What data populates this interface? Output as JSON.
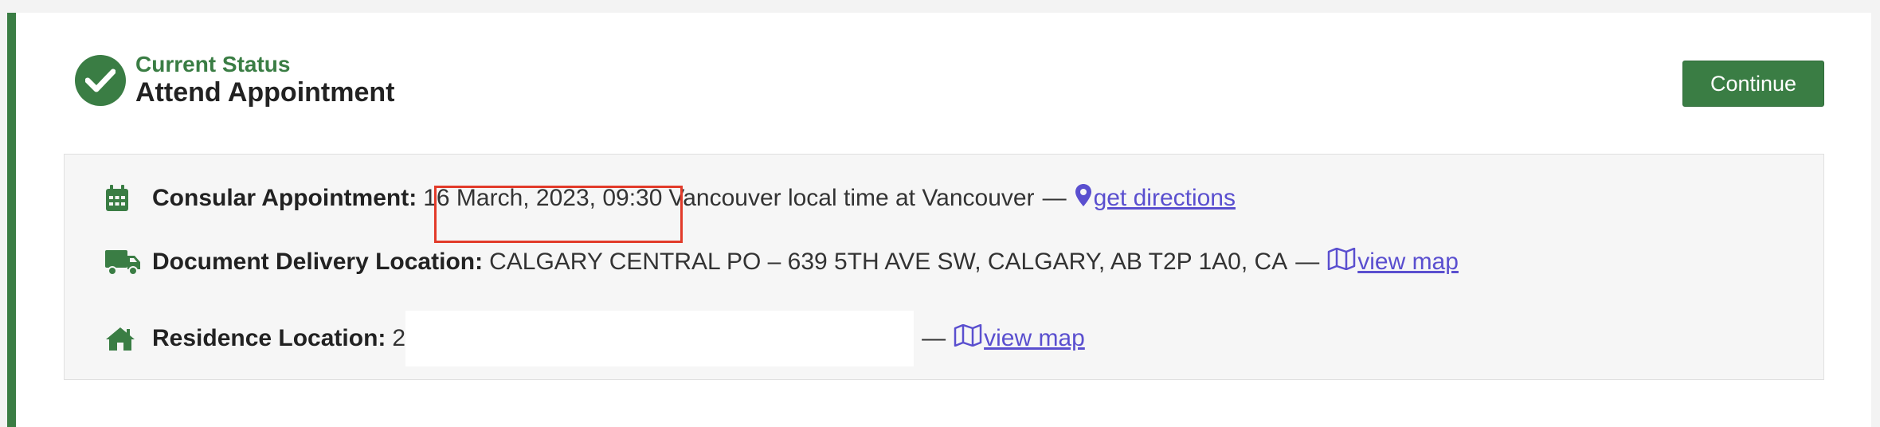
{
  "status": {
    "label": "Current Status",
    "title": "Attend Appointment",
    "icon": "check-circle-icon",
    "color": "#3a7d44"
  },
  "actions": {
    "continue_label": "Continue"
  },
  "details": {
    "consular": {
      "label": "Consular Appointment:",
      "datetime": "16 March, 2023, 09:30",
      "suffix": "Vancouver local time at Vancouver",
      "dash": "—",
      "link_label": "get directions",
      "icon": "calendar-icon",
      "link_icon": "map-pin-icon"
    },
    "delivery": {
      "label": "Document Delivery Location:",
      "value": "CALGARY CENTRAL PO – 639 5TH AVE SW, CALGARY, AB T2P 1A0, CA",
      "dash": "—",
      "link_label": "view map",
      "icon": "truck-icon",
      "link_icon": "map-icon"
    },
    "residence": {
      "label": "Residence Location:",
      "value_visible": "2",
      "dash": "—",
      "link_label": "view map",
      "icon": "home-icon",
      "link_icon": "map-icon"
    }
  },
  "colors": {
    "accent": "#3a7d44",
    "link": "#5a4fcf",
    "highlight": "#e23b2a"
  }
}
